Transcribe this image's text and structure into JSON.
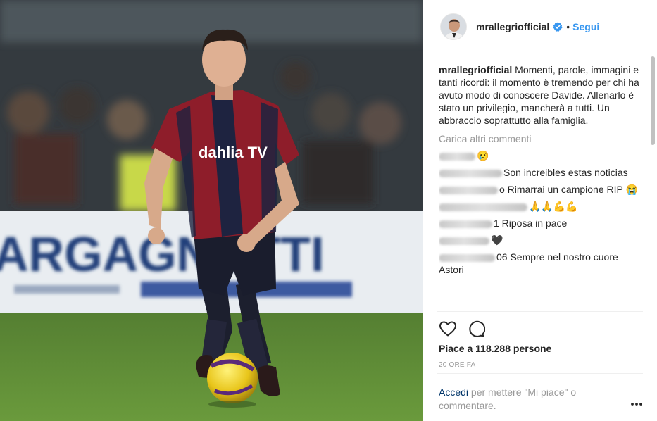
{
  "photo": {
    "banner_text": "ARGAGNOTTI",
    "shirt_sponsor": "dahlia TV"
  },
  "header": {
    "username": "mrallegriofficial",
    "verified_icon": "verified-badge-icon",
    "separator": "•",
    "follow_label": "Segui"
  },
  "caption": {
    "author": "mrallegriofficial",
    "text": "Momenti, parole, immagini e tanti ricordi: il momento è tremendo per chi ha avuto modo di conoscere Davide. Allenarlo è stato un privilegio, mancherà a tutti. Un abbraccio soprattutto alla famiglia."
  },
  "load_more_label": "Carica altri commenti",
  "comments": [
    {
      "text": "😢"
    },
    {
      "text": "Son increibles estas noticias"
    },
    {
      "text": "o Rimarrai un campione RIP 😭"
    },
    {
      "text": "🙏🙏💪💪"
    },
    {
      "text": "1 Riposa in pace"
    },
    {
      "text": "🖤"
    },
    {
      "text": "06 Sempre nel nostro cuore Astori"
    }
  ],
  "actions": {
    "like_icon": "heart-icon",
    "comment_icon": "comment-icon"
  },
  "likes_text": "Piace a 118.288 persone",
  "time_text": "20 ORE FA",
  "login": {
    "link_label": "Accedi",
    "rest": " per mettere \"Mi piace\" o commentare."
  },
  "more_icon": "more-options-icon",
  "colors": {
    "accent_blue": "#3897f0",
    "link_dark": "#003569",
    "muted": "#999999",
    "text": "#262626"
  }
}
